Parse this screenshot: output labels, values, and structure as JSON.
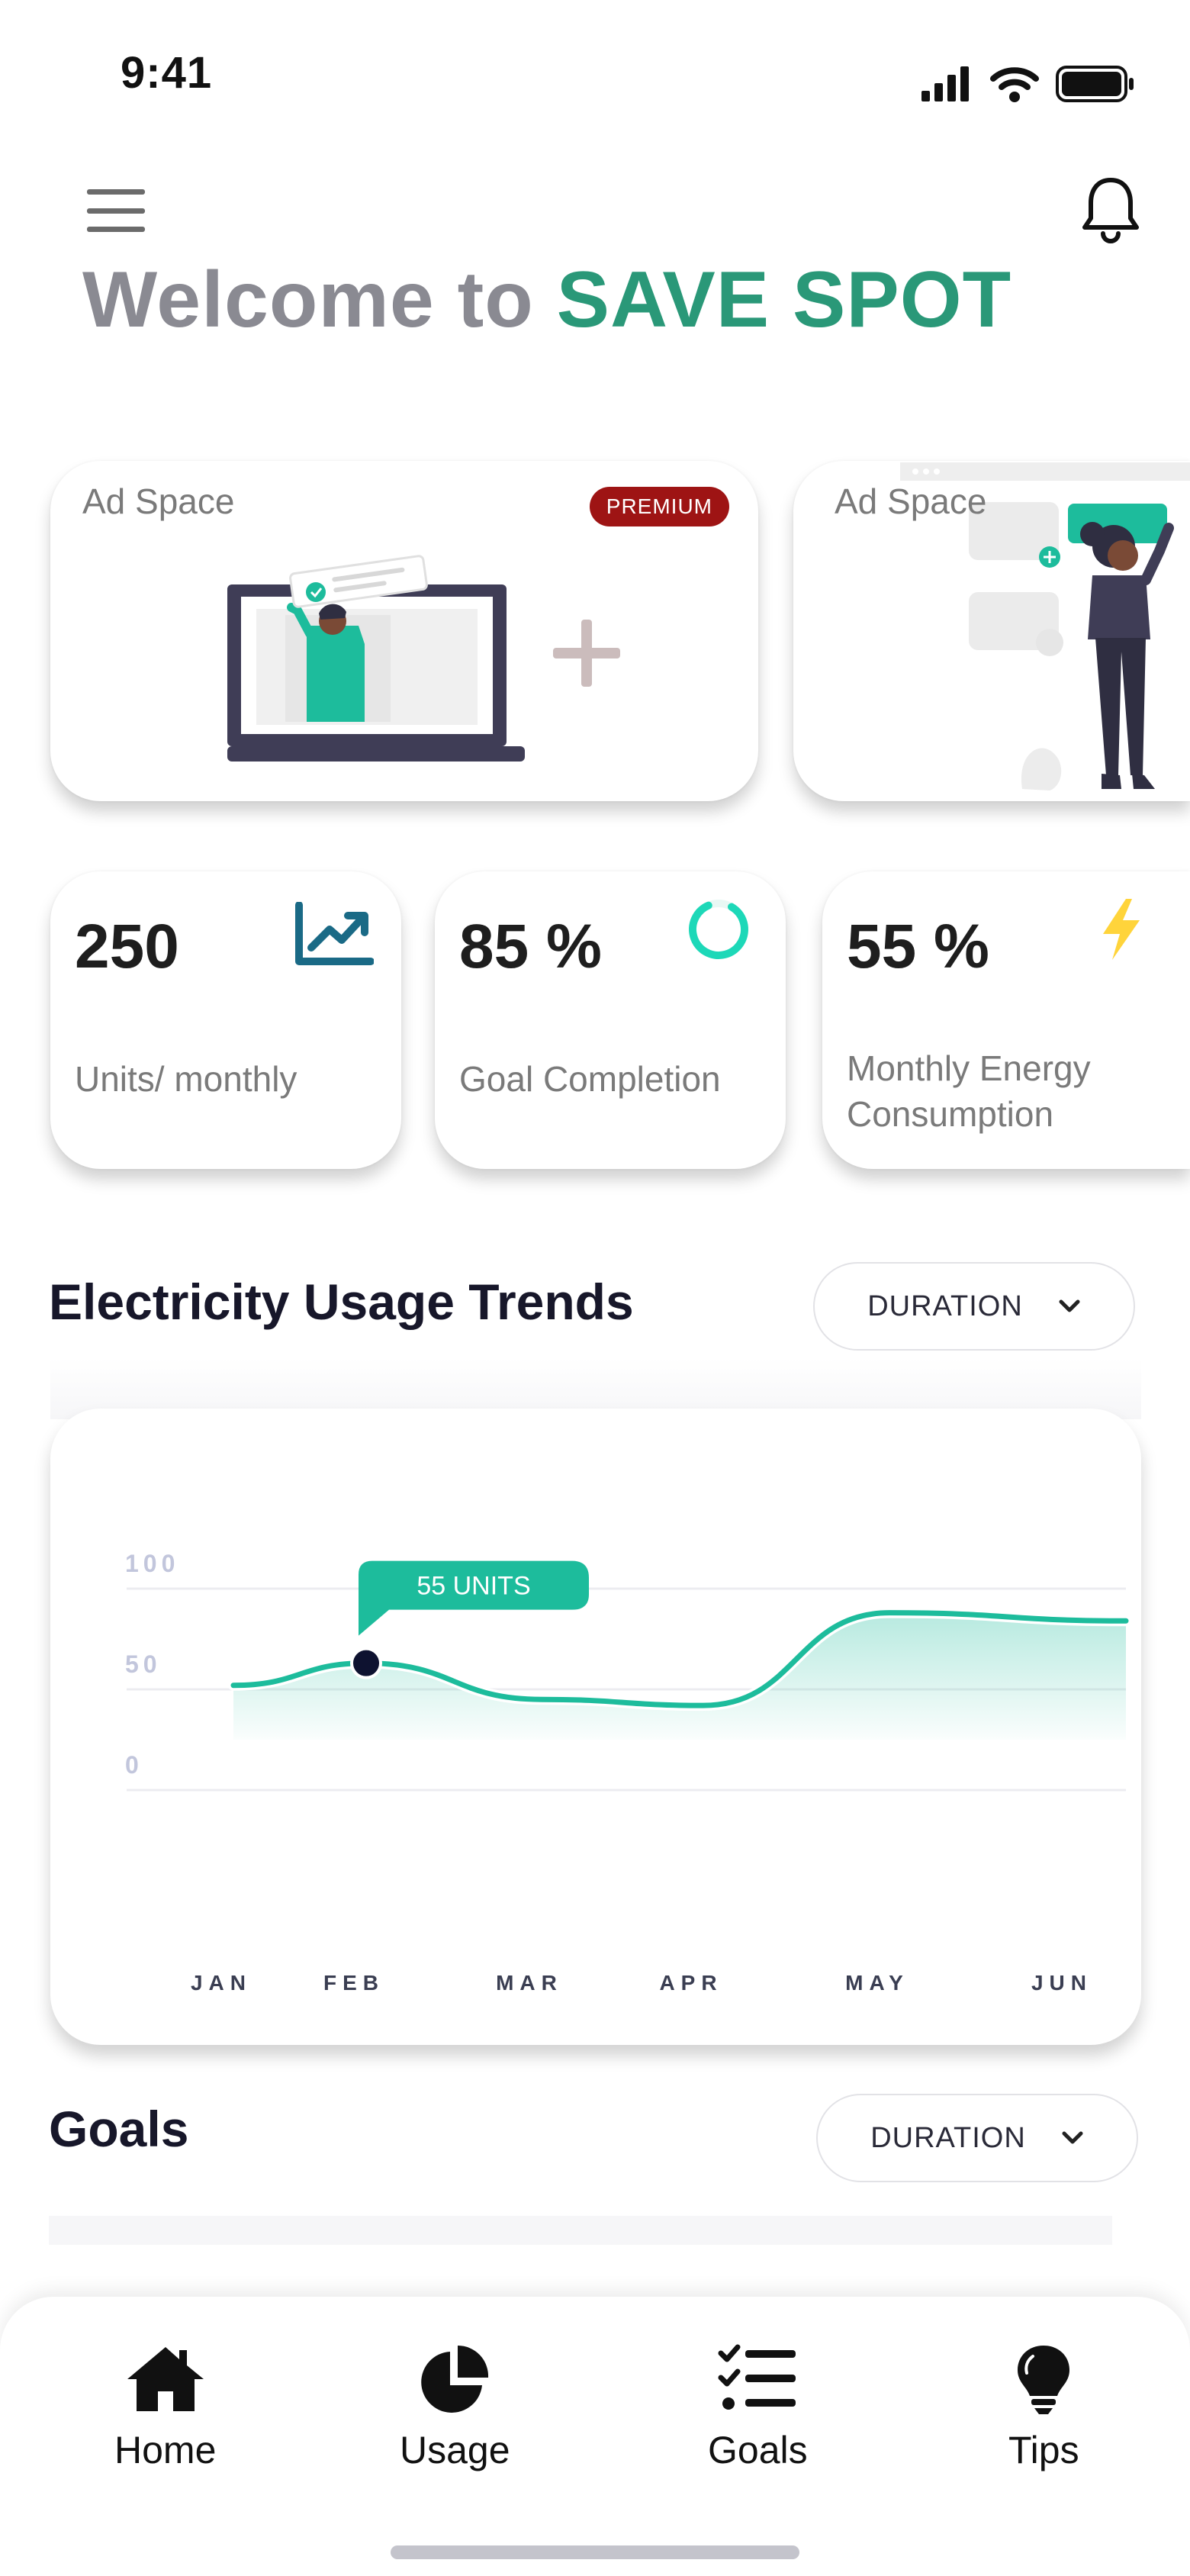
{
  "status_bar": {
    "time": "9:41",
    "icons": [
      "signal-icon",
      "wifi-icon",
      "battery-icon"
    ]
  },
  "header": {
    "welcome_prefix": "Welcome to ",
    "brand_name": "SAVE SPOT",
    "icons": [
      "menu-icon",
      "bell-icon"
    ]
  },
  "ads": [
    {
      "label": "Ad Space",
      "badge": "PREMIUM"
    },
    {
      "label": "Ad Space"
    }
  ],
  "stats": [
    {
      "value": "250",
      "label": "Units/ monthly",
      "icon": "trend-up-icon"
    },
    {
      "value": "85 %",
      "label": "Goal Completion",
      "icon": "progress-ring-icon"
    },
    {
      "value": "55 %",
      "label": "Monthly Energy Consumption",
      "icon": "lightning-icon"
    }
  ],
  "usage_section": {
    "title": "Electricity Usage Trends",
    "duration_label": "DURATION"
  },
  "goals_section": {
    "title": "Goals",
    "duration_label": "DURATION"
  },
  "colors": {
    "accent": "#1dbc9c",
    "brand": "#2a9878",
    "premium": "#9e1414",
    "lightning": "#ffd43b"
  },
  "chart_data": {
    "type": "area",
    "categories": [
      "JAN",
      "FEB",
      "MAR",
      "APR",
      "MAY",
      "JUN"
    ],
    "values": [
      52,
      63,
      45,
      42,
      88,
      84
    ],
    "y_ticks": [
      "100",
      "50",
      "0"
    ],
    "ylim": [
      0,
      100
    ],
    "grid": true,
    "tooltip": {
      "category": "FEB",
      "text": "55 UNITS"
    }
  },
  "nav": {
    "items": [
      {
        "label": "Home",
        "icon": "home-icon"
      },
      {
        "label": "Usage",
        "icon": "pie-chart-icon"
      },
      {
        "label": "Goals",
        "icon": "checklist-icon"
      },
      {
        "label": "Tips",
        "icon": "lightbulb-icon"
      }
    ]
  }
}
